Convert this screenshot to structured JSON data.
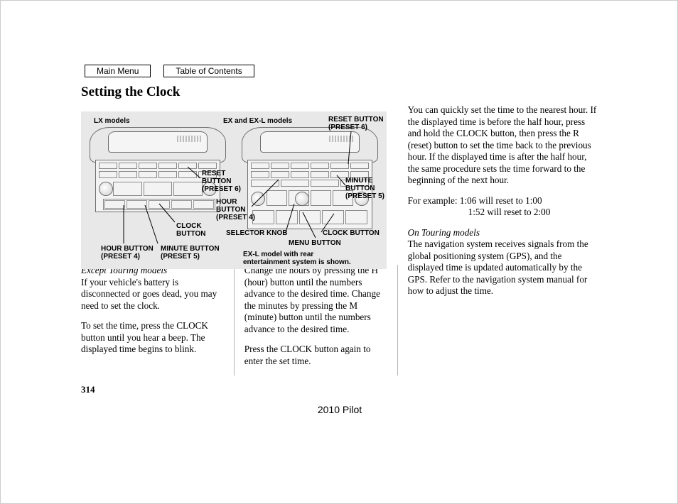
{
  "nav": {
    "main_menu": "Main Menu",
    "toc": "Table of Contents"
  },
  "title": "Setting the Clock",
  "diagram": {
    "lx_heading": "LX models",
    "ex_heading": "EX and EX-L models",
    "reset_button_6_a": "RESET\nBUTTON\n(PRESET 6)",
    "reset_button_6_b": "RESET BUTTON\n(PRESET 6)",
    "minute_button_5_b": "MINUTE\nBUTTON\n(PRESET 5)",
    "hour_button_4_b": "HOUR\nBUTTON\n(PRESET 4)",
    "clock_button": "CLOCK\nBUTTON",
    "clock_button_b": "CLOCK BUTTON",
    "selector_knob": "SELECTOR KNOB",
    "menu_button": "MENU BUTTON",
    "hour_button_4_a": "HOUR BUTTON\n(PRESET 4)",
    "minute_button_5_a": "MINUTE BUTTON\n(PRESET 5)",
    "exl_note": "EX-L model with rear\nentertainment system is shown."
  },
  "col1": {
    "heading": "Except Touring models",
    "p1": "If your vehicle's battery is disconnected or goes dead, you may need to set the clock.",
    "p2": "To set the time, press the CLOCK button until you hear a beep. The displayed time begins to blink."
  },
  "col2": {
    "p1": "Change the hours by pressing the H (hour) button until the numbers advance to the desired time. Change the minutes by pressing the M (minute) button until the numbers advance to the desired time.",
    "p2": "Press the CLOCK button again to enter the set time."
  },
  "col3": {
    "p1": "You can quickly set the time to the nearest hour. If the displayed time is before the half hour, press and hold the CLOCK button, then press the R (reset) button to set the time back to the previous hour. If the displayed time is after the half hour, the same procedure sets the time forward to the beginning of the next hour.",
    "ex_label": "For example:",
    "ex_line1": "1:06 will reset to 1:00",
    "ex_line2": "1:52 will reset to 2:00",
    "sub": "On Touring models",
    "p2": "The navigation system receives signals from the global positioning system (GPS), and the displayed time is updated automatically by the GPS. Refer to the navigation system manual for how to adjust the time."
  },
  "page_number": "314",
  "footer": "2010 Pilot"
}
